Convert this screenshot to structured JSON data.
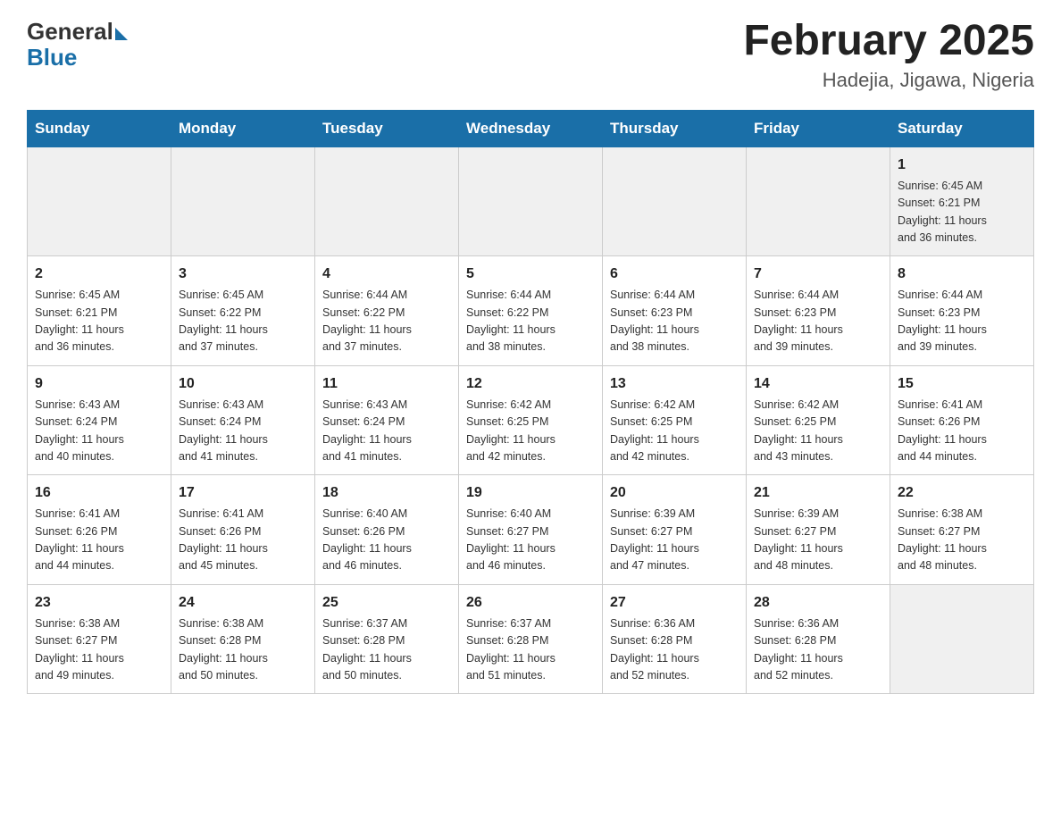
{
  "header": {
    "logo_general": "General",
    "logo_blue": "Blue",
    "month_year": "February 2025",
    "location": "Hadejia, Jigawa, Nigeria"
  },
  "days_of_week": [
    "Sunday",
    "Monday",
    "Tuesday",
    "Wednesday",
    "Thursday",
    "Friday",
    "Saturday"
  ],
  "weeks": [
    [
      {
        "day": "",
        "info": ""
      },
      {
        "day": "",
        "info": ""
      },
      {
        "day": "",
        "info": ""
      },
      {
        "day": "",
        "info": ""
      },
      {
        "day": "",
        "info": ""
      },
      {
        "day": "",
        "info": ""
      },
      {
        "day": "1",
        "info": "Sunrise: 6:45 AM\nSunset: 6:21 PM\nDaylight: 11 hours\nand 36 minutes."
      }
    ],
    [
      {
        "day": "2",
        "info": "Sunrise: 6:45 AM\nSunset: 6:21 PM\nDaylight: 11 hours\nand 36 minutes."
      },
      {
        "day": "3",
        "info": "Sunrise: 6:45 AM\nSunset: 6:22 PM\nDaylight: 11 hours\nand 37 minutes."
      },
      {
        "day": "4",
        "info": "Sunrise: 6:44 AM\nSunset: 6:22 PM\nDaylight: 11 hours\nand 37 minutes."
      },
      {
        "day": "5",
        "info": "Sunrise: 6:44 AM\nSunset: 6:22 PM\nDaylight: 11 hours\nand 38 minutes."
      },
      {
        "day": "6",
        "info": "Sunrise: 6:44 AM\nSunset: 6:23 PM\nDaylight: 11 hours\nand 38 minutes."
      },
      {
        "day": "7",
        "info": "Sunrise: 6:44 AM\nSunset: 6:23 PM\nDaylight: 11 hours\nand 39 minutes."
      },
      {
        "day": "8",
        "info": "Sunrise: 6:44 AM\nSunset: 6:23 PM\nDaylight: 11 hours\nand 39 minutes."
      }
    ],
    [
      {
        "day": "9",
        "info": "Sunrise: 6:43 AM\nSunset: 6:24 PM\nDaylight: 11 hours\nand 40 minutes."
      },
      {
        "day": "10",
        "info": "Sunrise: 6:43 AM\nSunset: 6:24 PM\nDaylight: 11 hours\nand 41 minutes."
      },
      {
        "day": "11",
        "info": "Sunrise: 6:43 AM\nSunset: 6:24 PM\nDaylight: 11 hours\nand 41 minutes."
      },
      {
        "day": "12",
        "info": "Sunrise: 6:42 AM\nSunset: 6:25 PM\nDaylight: 11 hours\nand 42 minutes."
      },
      {
        "day": "13",
        "info": "Sunrise: 6:42 AM\nSunset: 6:25 PM\nDaylight: 11 hours\nand 42 minutes."
      },
      {
        "day": "14",
        "info": "Sunrise: 6:42 AM\nSunset: 6:25 PM\nDaylight: 11 hours\nand 43 minutes."
      },
      {
        "day": "15",
        "info": "Sunrise: 6:41 AM\nSunset: 6:26 PM\nDaylight: 11 hours\nand 44 minutes."
      }
    ],
    [
      {
        "day": "16",
        "info": "Sunrise: 6:41 AM\nSunset: 6:26 PM\nDaylight: 11 hours\nand 44 minutes."
      },
      {
        "day": "17",
        "info": "Sunrise: 6:41 AM\nSunset: 6:26 PM\nDaylight: 11 hours\nand 45 minutes."
      },
      {
        "day": "18",
        "info": "Sunrise: 6:40 AM\nSunset: 6:26 PM\nDaylight: 11 hours\nand 46 minutes."
      },
      {
        "day": "19",
        "info": "Sunrise: 6:40 AM\nSunset: 6:27 PM\nDaylight: 11 hours\nand 46 minutes."
      },
      {
        "day": "20",
        "info": "Sunrise: 6:39 AM\nSunset: 6:27 PM\nDaylight: 11 hours\nand 47 minutes."
      },
      {
        "day": "21",
        "info": "Sunrise: 6:39 AM\nSunset: 6:27 PM\nDaylight: 11 hours\nand 48 minutes."
      },
      {
        "day": "22",
        "info": "Sunrise: 6:38 AM\nSunset: 6:27 PM\nDaylight: 11 hours\nand 48 minutes."
      }
    ],
    [
      {
        "day": "23",
        "info": "Sunrise: 6:38 AM\nSunset: 6:27 PM\nDaylight: 11 hours\nand 49 minutes."
      },
      {
        "day": "24",
        "info": "Sunrise: 6:38 AM\nSunset: 6:28 PM\nDaylight: 11 hours\nand 50 minutes."
      },
      {
        "day": "25",
        "info": "Sunrise: 6:37 AM\nSunset: 6:28 PM\nDaylight: 11 hours\nand 50 minutes."
      },
      {
        "day": "26",
        "info": "Sunrise: 6:37 AM\nSunset: 6:28 PM\nDaylight: 11 hours\nand 51 minutes."
      },
      {
        "day": "27",
        "info": "Sunrise: 6:36 AM\nSunset: 6:28 PM\nDaylight: 11 hours\nand 52 minutes."
      },
      {
        "day": "28",
        "info": "Sunrise: 6:36 AM\nSunset: 6:28 PM\nDaylight: 11 hours\nand 52 minutes."
      },
      {
        "day": "",
        "info": ""
      }
    ]
  ]
}
